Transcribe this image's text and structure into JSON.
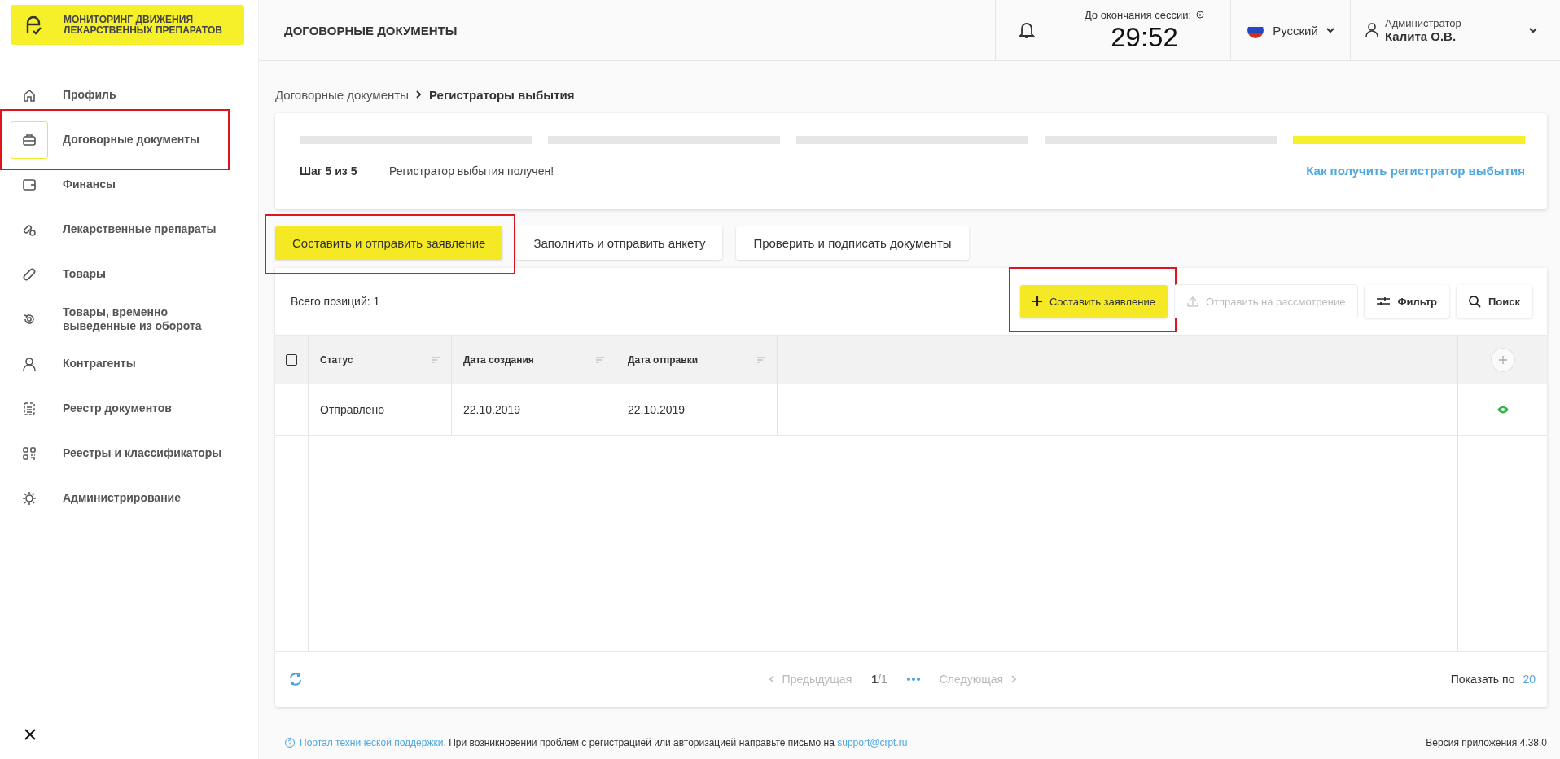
{
  "logo": {
    "lines": [
      "МОНИТОРИНГ ДВИЖЕНИЯ",
      "ЛЕКАРСТВЕННЫХ ПРЕПАРАТОВ"
    ]
  },
  "sidebar": {
    "items": [
      {
        "label": "Профиль",
        "selected": false,
        "highlighted": false
      },
      {
        "label": "Договорные документы",
        "selected": true,
        "highlighted": true
      },
      {
        "label": "Финансы",
        "selected": false,
        "highlighted": false
      },
      {
        "label": "Лекарственные препараты",
        "selected": false,
        "highlighted": false
      },
      {
        "label": "Товары",
        "selected": false,
        "highlighted": false
      },
      {
        "label": "Товары, временно выведенные из оборота",
        "selected": false,
        "highlighted": false
      },
      {
        "label": "Контрагенты",
        "selected": false,
        "highlighted": false
      },
      {
        "label": "Реестр документов",
        "selected": false,
        "highlighted": false
      },
      {
        "label": "Реестры и классификаторы",
        "selected": false,
        "highlighted": false
      },
      {
        "label": "Администрирование",
        "selected": false,
        "highlighted": false
      }
    ]
  },
  "header": {
    "title": "ДОГОВОРНЫЕ ДОКУМЕНТЫ",
    "session_label": "До окончания сессии:",
    "session_time": "29:52",
    "language": "Русский",
    "user_role": "Администратор",
    "user_name": "Калита О.В."
  },
  "breadcrumb": [
    {
      "label": "Договорные документы",
      "current": false
    },
    {
      "label": "Регистраторы выбытия",
      "current": true
    }
  ],
  "steps": {
    "bars": [
      {
        "selected": false
      },
      {
        "selected": false
      },
      {
        "selected": false
      },
      {
        "selected": false
      },
      {
        "selected": true
      }
    ],
    "step_label": "Шаг 5 из 5",
    "status": "Регистратор выбытия получен!",
    "help_link": "Как получить регистратор выбытия"
  },
  "stage_tabs": [
    {
      "label": "Составить и отправить заявление",
      "selected": true,
      "highlighted": true
    },
    {
      "label": "Заполнить и отправить анкету",
      "selected": false,
      "highlighted": false
    },
    {
      "label": "Проверить и подписать документы",
      "selected": false,
      "highlighted": false
    }
  ],
  "table": {
    "total": "Всего позиций: 1",
    "actions": [
      {
        "kind": "create",
        "label": "Составить заявление",
        "disabled": false,
        "highlighted": true
      },
      {
        "kind": "send",
        "label": "Отправить на рассмотрение",
        "disabled": true,
        "highlighted": false
      },
      {
        "kind": "filter",
        "label": "Фильтр",
        "disabled": false,
        "highlighted": false
      },
      {
        "kind": "search",
        "label": "Поиск",
        "disabled": false,
        "highlighted": false
      }
    ],
    "select_all": {
      "checked": false
    },
    "columns": [
      "Статус",
      "Дата создания",
      "Дата отправки"
    ],
    "rows": [
      {
        "cells": [
          "Отправлено",
          "22.10.2019",
          "22.10.2019"
        ]
      }
    ],
    "pagination": {
      "prev": "Предыдущая",
      "page_current": "1",
      "page_total": "/1",
      "next": "Следующая",
      "page_size_label": "Показать по",
      "page_size": "20"
    }
  },
  "footer": {
    "support_link": "Портал технической поддержки.",
    "message": "При возникновении проблем с регистрацией или авторизацией направьте письмо на",
    "email": "support@crpt.ru",
    "version": "Версия приложения 4.38.0"
  }
}
